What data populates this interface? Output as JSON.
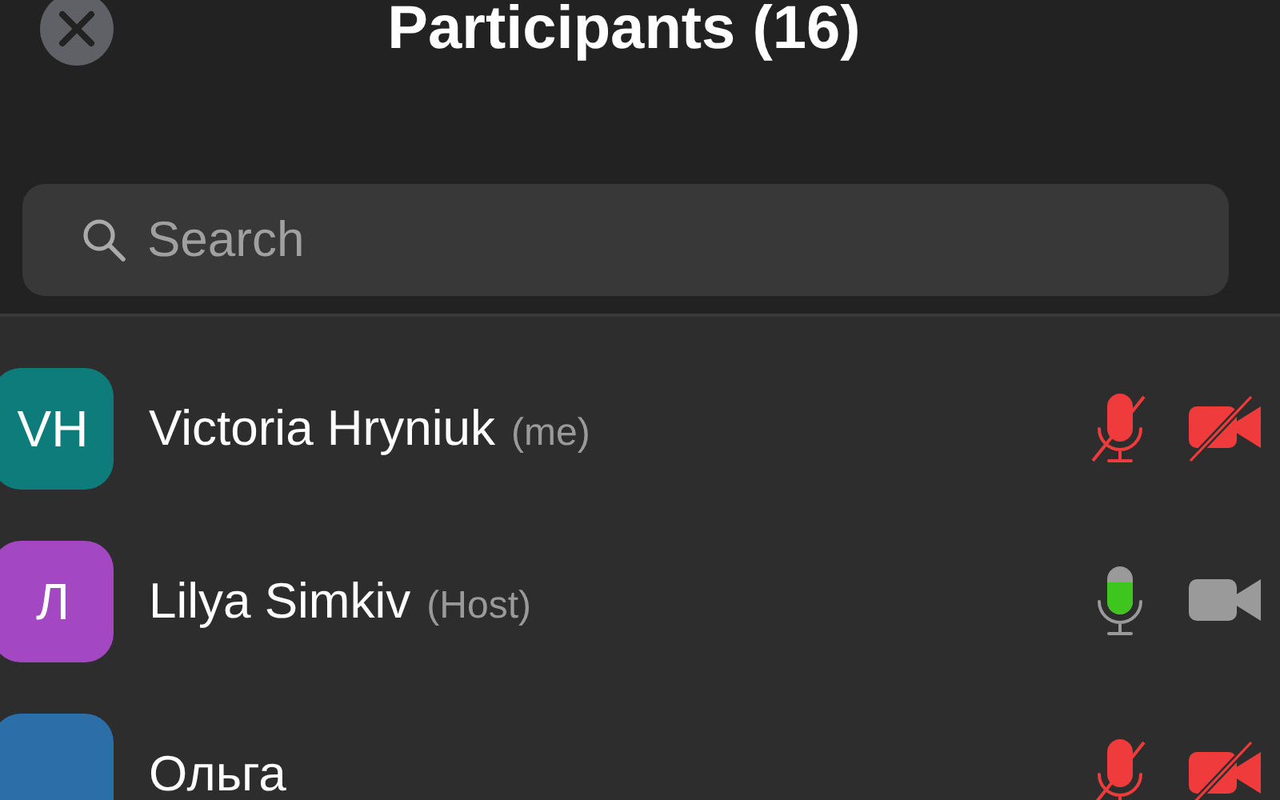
{
  "header": {
    "title": "Participants (16)"
  },
  "search": {
    "placeholder": "Search"
  },
  "participants": [
    {
      "initials": "VH",
      "color": "#0e7c7b",
      "name": "Victoria Hryniuk",
      "tag": "(me)",
      "mic": {
        "muted": true
      },
      "camera_off": true
    },
    {
      "initials": "Л",
      "color": "#a347c3",
      "name": "Lilya Simkiv",
      "tag": "(Host)",
      "mic": {
        "muted": false,
        "speaking": true
      },
      "camera_off": false
    },
    {
      "color": "#2c6ea8",
      "name": "Ольга",
      "mic": {
        "muted": true
      },
      "camera_off": true
    }
  ]
}
